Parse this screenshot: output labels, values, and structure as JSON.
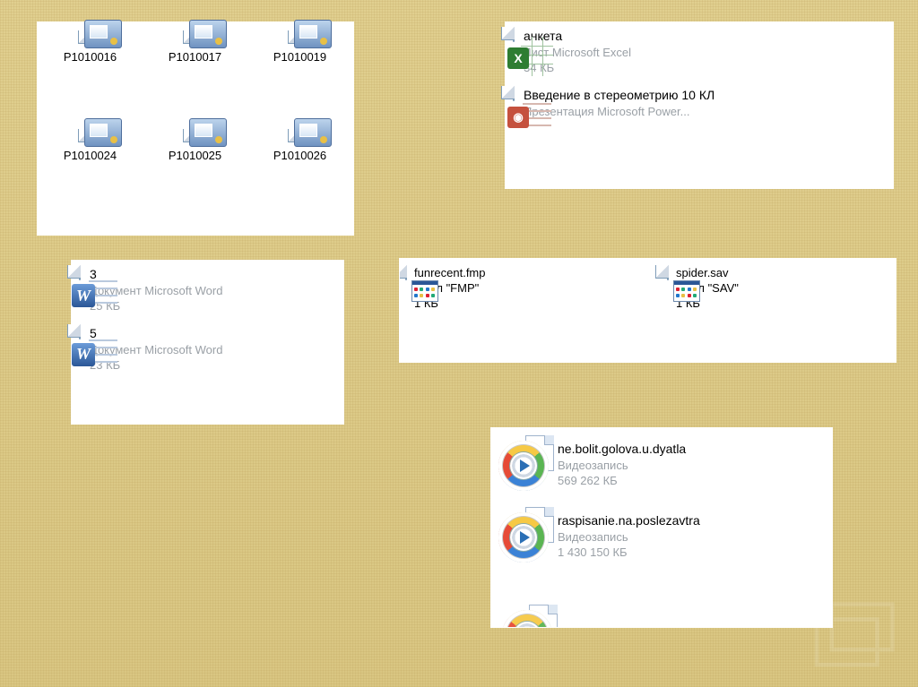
{
  "panel1": {
    "items": [
      {
        "label": "P1010016"
      },
      {
        "label": "P1010017"
      },
      {
        "label": "P1010019"
      },
      {
        "label": "P1010024"
      },
      {
        "label": "P1010025"
      },
      {
        "label": "P1010026"
      }
    ]
  },
  "panel2": {
    "items": [
      {
        "name": "анкета",
        "type": "Лист Microsoft Excel",
        "size": "34 КБ",
        "kind": "excel"
      },
      {
        "name": "Введение в стереометрию 10 КЛ",
        "type": "Презентация Microsoft Power...",
        "size": "",
        "kind": "powerpoint"
      }
    ]
  },
  "panel3": {
    "items": [
      {
        "name": "3",
        "type": "Документ Microsoft Word",
        "size": "25 КБ"
      },
      {
        "name": "5",
        "type": "Документ Microsoft Word",
        "size": "23 КБ"
      }
    ]
  },
  "panel4": {
    "items": [
      {
        "name": "funrecent.fmp",
        "type": "Файл \"FMP\"",
        "size": "1 КБ"
      },
      {
        "name": "spider.sav",
        "type": "Файл \"SAV\"",
        "size": "1 КБ"
      }
    ]
  },
  "panel5": {
    "items": [
      {
        "name": "ne.bolit.golova.u.dyatla",
        "type": "Видеозапись",
        "size": "569 262 КБ"
      },
      {
        "name": "raspisanie.na.poslezavtra",
        "type": "Видеозапись",
        "size": "1 430 150 КБ"
      }
    ]
  }
}
